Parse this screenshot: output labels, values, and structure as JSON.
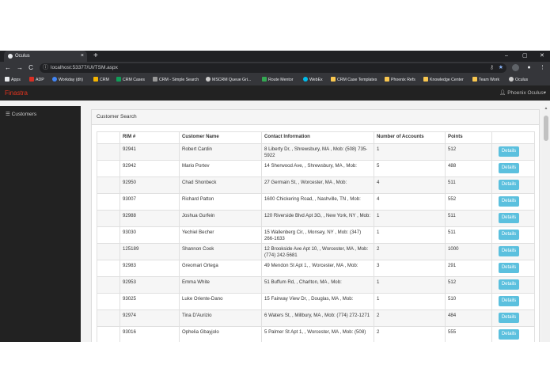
{
  "browser": {
    "tab_title": "Oculus",
    "tab_close": "×",
    "new_tab": "+",
    "window_controls": [
      "–",
      "▢",
      "✕"
    ],
    "nav": {
      "back": "←",
      "forward": "→",
      "reload": "C"
    },
    "url": "localhost:53377/UI/TSM.aspx",
    "star_color": "#8ab4f8"
  },
  "bookmarks": [
    {
      "label": "Apps",
      "color": "#e8eaed"
    },
    {
      "label": "ADP",
      "color": "#d93025"
    },
    {
      "label": "Workday (dh)",
      "color": "#4285f4"
    },
    {
      "label": "CRM",
      "color": "#f4b400"
    },
    {
      "label": "CRM Cases",
      "color": "#0f9d58"
    },
    {
      "label": "CRM - Simple Search",
      "color": "#999999"
    },
    {
      "label": "MSCRM Queue Gri...",
      "color": "#cccccc"
    },
    {
      "label": "Route Mentor",
      "color": "#34a853"
    },
    {
      "label": "WebEx",
      "color": "#00bceb"
    },
    {
      "label": "CRM Case Templates",
      "color": "#f9c74f"
    },
    {
      "label": "Phoenix Refs",
      "color": "#f9c74f"
    },
    {
      "label": "Knowledge Center",
      "color": "#f9c74f"
    },
    {
      "label": "Team Work",
      "color": "#f9c74f"
    },
    {
      "label": "Oculus",
      "color": "#cccccc"
    }
  ],
  "app": {
    "brand": "Finastra",
    "brand_color": "#e0341f",
    "user": "Phoenix Oculus",
    "sidebar": {
      "item": "Customers"
    }
  },
  "panel": {
    "title": "Customer Search",
    "columns": [
      "",
      "RIM #",
      "Customer Name",
      "Contact Information",
      "Number of Accounts",
      "Points",
      ""
    ],
    "details_label": "Details",
    "details_color": "#5bc0de",
    "rows": [
      {
        "rim": "92941",
        "name": "Robert Cardin",
        "contact": "8 Liberty Dr, , Shrewsbury, MA , Mob: (508) 735-5922",
        "accounts": "1",
        "points": "512"
      },
      {
        "rim": "92942",
        "name": "Mario Portev",
        "contact": "14 Sherwood Ave, , Shrewsbury, MA , Mob:",
        "accounts": "5",
        "points": "488"
      },
      {
        "rim": "92950",
        "name": "Chad Shonbeck",
        "contact": "27 Germain St, , Worcester, MA , Mob:",
        "accounts": "4",
        "points": "511"
      },
      {
        "rim": "93007",
        "name": "Richard Patton",
        "contact": "1600 Chickering Road, , Nashville, TN , Mob:",
        "accounts": "4",
        "points": "552"
      },
      {
        "rim": "92988",
        "name": "Joshua Gurfein",
        "contact": "120 Riverside Blvd Apt 3G, , New York, NY , Mob:",
        "accounts": "1",
        "points": "511"
      },
      {
        "rim": "93030",
        "name": "Yechiel Becher",
        "contact": "15 Wallenberg Cir, , Monsey, NY , Mob: (347) 266-1633",
        "accounts": "1",
        "points": "511"
      },
      {
        "rim": "125189",
        "name": "Shannon Cook",
        "contact": "12 Brookside Ave Apt 10, , Worcester, MA , Mob: (774) 242-5681",
        "accounts": "2",
        "points": "1000"
      },
      {
        "rim": "92983",
        "name": "Greomari Ortega",
        "contact": "49 Mendon St Apt 1, , Worcester, MA , Mob:",
        "accounts": "3",
        "points": "291"
      },
      {
        "rim": "92953",
        "name": "Emma White",
        "contact": "51 Buffum Rd, , Charlton, MA , Mob:",
        "accounts": "1",
        "points": "512"
      },
      {
        "rim": "93025",
        "name": "Luke Oriente-Dano",
        "contact": "15 Fairway View Dr, , Douglas, MA , Mob:",
        "accounts": "1",
        "points": "510"
      },
      {
        "rim": "92974",
        "name": "Tina D'Aurizio",
        "contact": "6 Waters St, , Millbury, MA , Mob: (774) 272-1271",
        "accounts": "2",
        "points": "484"
      },
      {
        "rim": "93016",
        "name": "Ophelia Gbayjolo",
        "contact": "5 Palmer St Apt 1, , Worcester, MA , Mob: (508)",
        "accounts": "2",
        "points": "555"
      }
    ]
  }
}
